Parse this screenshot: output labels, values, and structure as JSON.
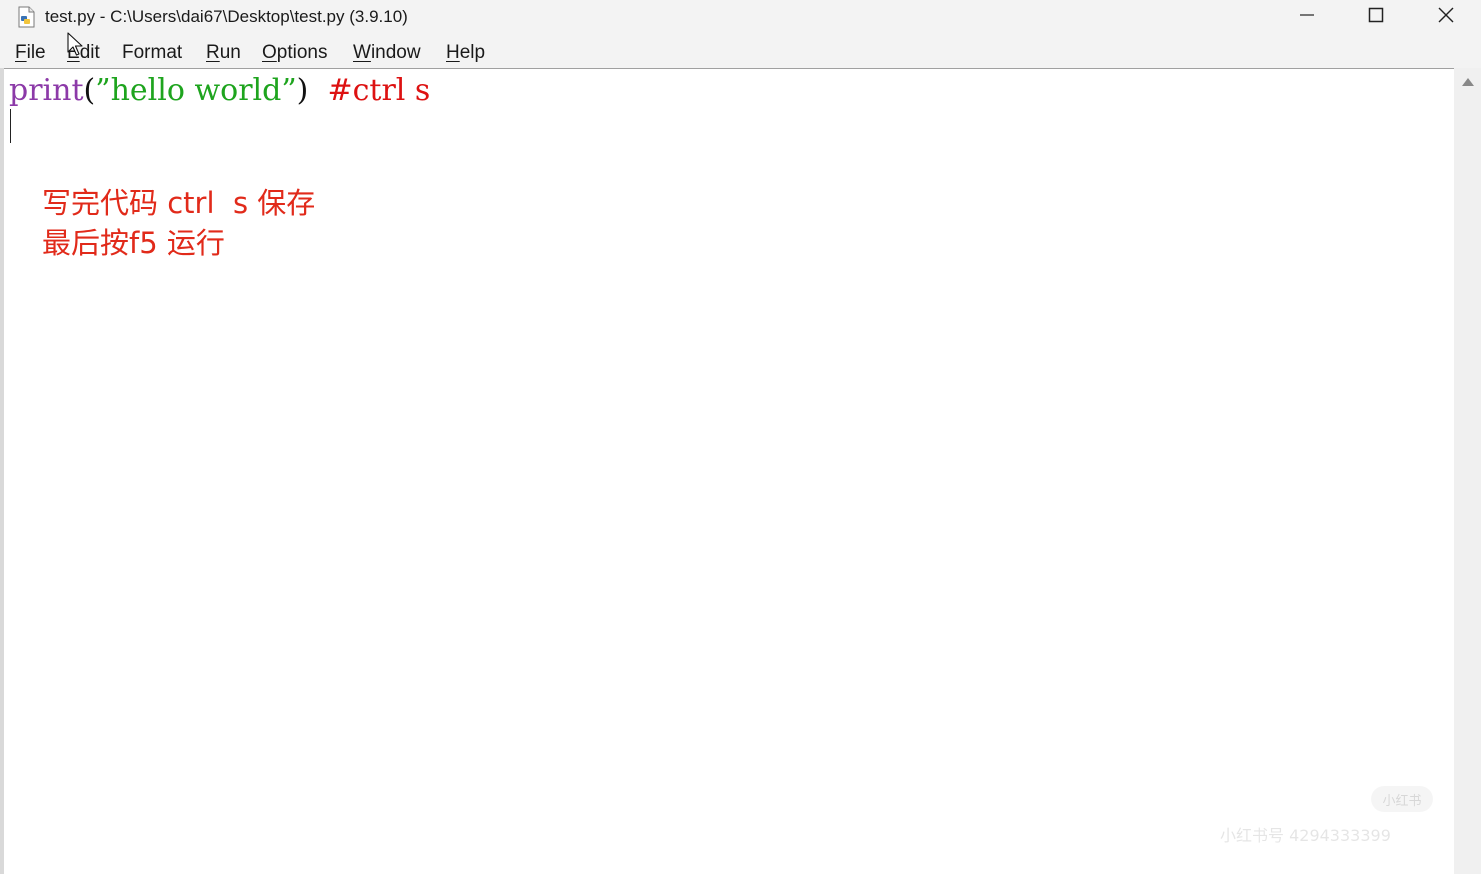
{
  "window": {
    "title": "test.py - C:\\Users\\dai67\\Desktop\\test.py (3.9.10)"
  },
  "menu": {
    "file": {
      "first": "F",
      "rest": "ile"
    },
    "edit": {
      "first": "E",
      "rest": "dit"
    },
    "format": {
      "first": "Format",
      "rest": ""
    },
    "run": {
      "first": "R",
      "rest": "un"
    },
    "options": {
      "first": "O",
      "rest": "ptions"
    },
    "window": {
      "first": "W",
      "rest": "indow"
    },
    "help": {
      "first": "H",
      "rest": "elp"
    }
  },
  "editor": {
    "code": {
      "keyword": "print",
      "open_paren": "(",
      "string": "”hello world”",
      "close_paren": ")",
      "spacing": "  ",
      "comment": "#ctrl s"
    },
    "annotation_line1": "写完代码 ctrl  s 保存",
    "annotation_line2": "最后按f5 运行"
  },
  "watermark": {
    "badge": "小红书",
    "text": "小红书号 4294333399"
  },
  "icons": {
    "app": "python-file-icon",
    "minimize": "minimize-icon",
    "maximize": "maximize-icon",
    "close": "close-icon",
    "scroll_up": "scroll-up-arrow-icon",
    "cursor": "mouse-pointer-icon"
  },
  "colors": {
    "keyword": "#8c3aa8",
    "string": "#1ea41e",
    "comment": "#dd1111",
    "annotation": "#e12a1a"
  }
}
